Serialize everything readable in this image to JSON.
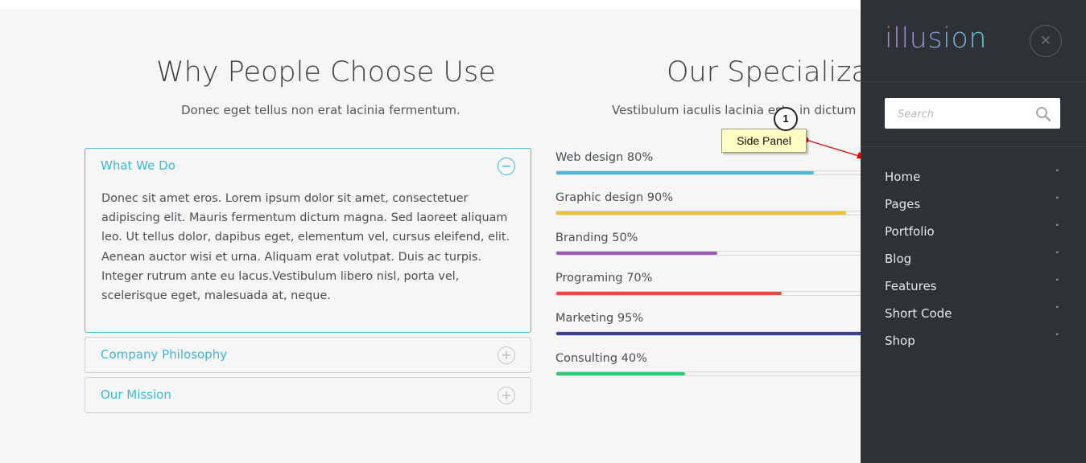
{
  "left_section": {
    "title": "Why People Choose Use",
    "subtitle": "Donec eget tellus non erat lacinia fermentum."
  },
  "accordion": [
    {
      "title": "What We Do",
      "expanded": true,
      "toggle_symbol": "−",
      "body": "Donec sit amet eros. Lorem ipsum dolor sit amet, consectetuer adipiscing elit. Mauris fermentum dictum magna. Sed laoreet aliquam leo. Ut tellus dolor, dapibus eget, elementum vel, cursus eleifend, elit. Aenean auctor wisi et urna. Aliquam erat volutpat. Duis ac turpis. Integer rutrum ante eu lacus.Vestibulum libero nisl, porta vel, scelerisque eget, malesuada at, neque."
    },
    {
      "title": "Company Philosophy",
      "expanded": false,
      "toggle_symbol": "+"
    },
    {
      "title": "Our Mission",
      "expanded": false,
      "toggle_symbol": "+"
    }
  ],
  "right_section": {
    "title": "Our Specializati",
    "subtitle_left": "Vestibulum iaculis lacinia est.",
    "subtitle_right": "in dictum el"
  },
  "skills": [
    {
      "label": "Web design 80%",
      "percent": 80,
      "color": "#4fb9d8"
    },
    {
      "label": "Graphic design 90%",
      "percent": 90,
      "color": "#e8c32c"
    },
    {
      "label": "Branding 50%",
      "percent": 50,
      "color": "#9b59b6"
    },
    {
      "label": "Programing 70%",
      "percent": 70,
      "color": "#e74c3c"
    },
    {
      "label": "Marketing 95%",
      "percent": 95,
      "color": "#3d3f8f"
    },
    {
      "label": "Consulting 40%",
      "percent": 40,
      "color": "#2ecc71"
    }
  ],
  "callout": {
    "number": "1",
    "label": "Side Panel"
  },
  "side_panel": {
    "logo": "illusion",
    "close_symbol": "✕",
    "search_placeholder": "Search",
    "nav": [
      {
        "label": "Home",
        "chevron": "˅"
      },
      {
        "label": "Pages",
        "chevron": "˅"
      },
      {
        "label": "Portfolio",
        "chevron": "˅"
      },
      {
        "label": "Blog",
        "chevron": "˅"
      },
      {
        "label": "Features",
        "chevron": "˅"
      },
      {
        "label": "Short Code",
        "chevron": "˅"
      },
      {
        "label": "Shop",
        "chevron": "˅"
      }
    ]
  },
  "colors": {
    "accent": "#3cb7d6",
    "panel_bg": "#2e3136",
    "page_bg": "#f5f6f5"
  }
}
